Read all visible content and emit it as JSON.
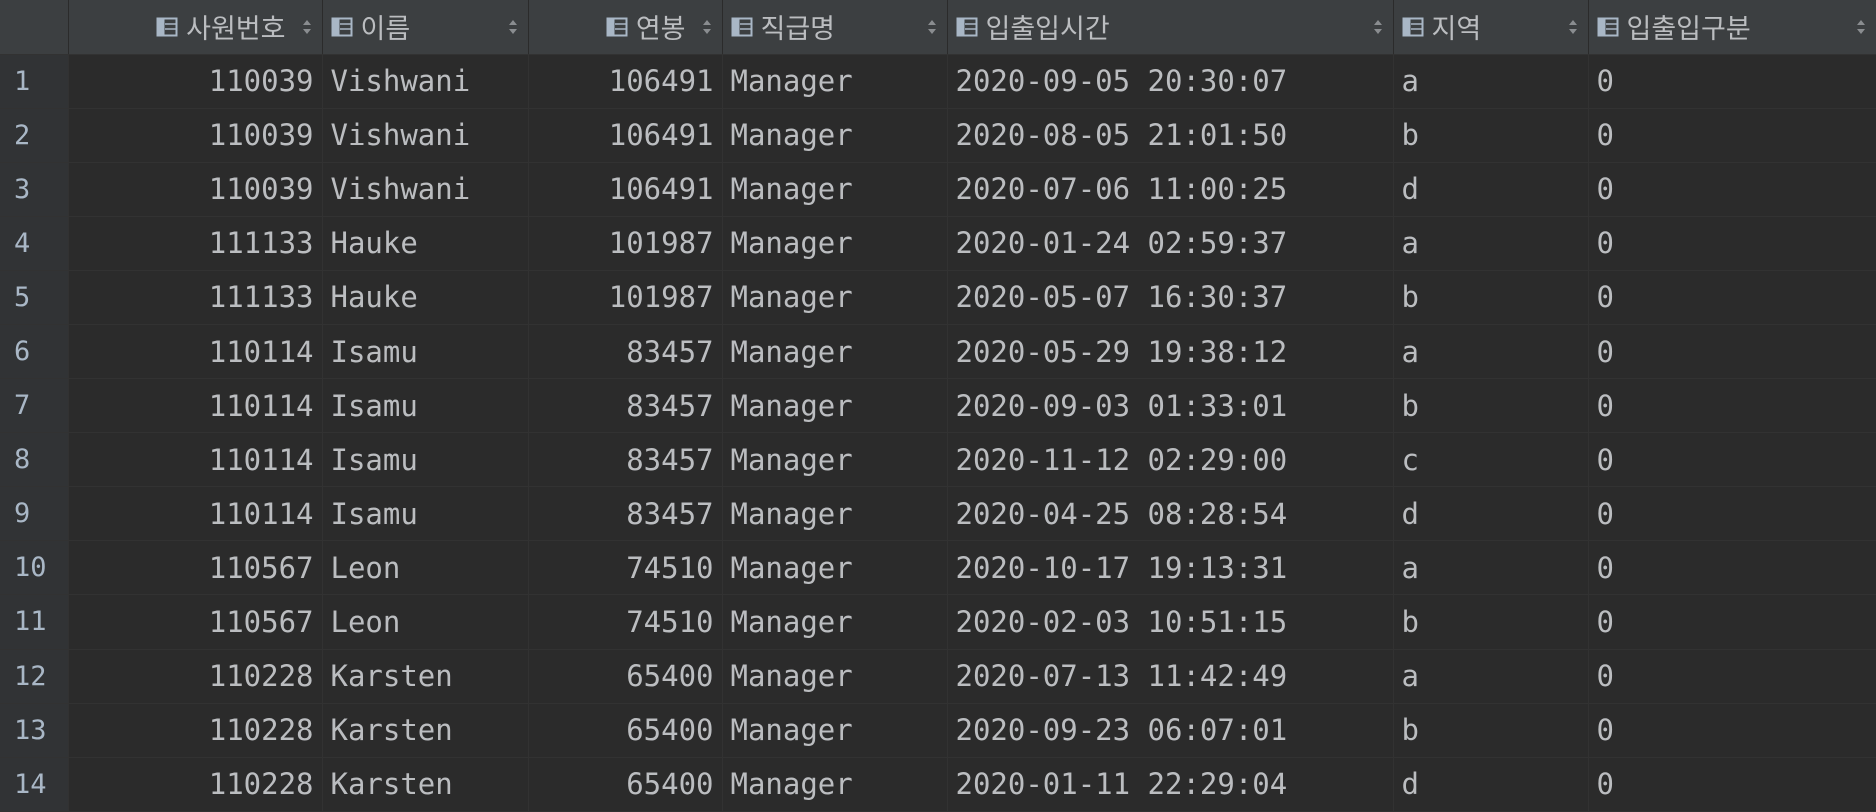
{
  "table": {
    "columns": [
      {
        "label": "사원번호",
        "align": "right"
      },
      {
        "label": "이름",
        "align": "left"
      },
      {
        "label": "연봉",
        "align": "right"
      },
      {
        "label": "직급명",
        "align": "left"
      },
      {
        "label": "입출입시간",
        "align": "left"
      },
      {
        "label": "지역",
        "align": "left"
      },
      {
        "label": "입출입구분",
        "align": "left"
      }
    ],
    "rows": [
      {
        "num": "1",
        "cells": [
          "110039",
          "Vishwani",
          "106491",
          "Manager",
          "2020-09-05 20:30:07",
          "a",
          "0"
        ]
      },
      {
        "num": "2",
        "cells": [
          "110039",
          "Vishwani",
          "106491",
          "Manager",
          "2020-08-05 21:01:50",
          "b",
          "0"
        ]
      },
      {
        "num": "3",
        "cells": [
          "110039",
          "Vishwani",
          "106491",
          "Manager",
          "2020-07-06 11:00:25",
          "d",
          "0"
        ]
      },
      {
        "num": "4",
        "cells": [
          "111133",
          "Hauke",
          "101987",
          "Manager",
          "2020-01-24 02:59:37",
          "a",
          "0"
        ]
      },
      {
        "num": "5",
        "cells": [
          "111133",
          "Hauke",
          "101987",
          "Manager",
          "2020-05-07 16:30:37",
          "b",
          "0"
        ]
      },
      {
        "num": "6",
        "cells": [
          "110114",
          "Isamu",
          "83457",
          "Manager",
          "2020-05-29 19:38:12",
          "a",
          "0"
        ]
      },
      {
        "num": "7",
        "cells": [
          "110114",
          "Isamu",
          "83457",
          "Manager",
          "2020-09-03 01:33:01",
          "b",
          "0"
        ]
      },
      {
        "num": "8",
        "cells": [
          "110114",
          "Isamu",
          "83457",
          "Manager",
          "2020-11-12 02:29:00",
          "c",
          "0"
        ]
      },
      {
        "num": "9",
        "cells": [
          "110114",
          "Isamu",
          "83457",
          "Manager",
          "2020-04-25 08:28:54",
          "d",
          "0"
        ]
      },
      {
        "num": "10",
        "cells": [
          "110567",
          "Leon",
          "74510",
          "Manager",
          "2020-10-17 19:13:31",
          "a",
          "0"
        ]
      },
      {
        "num": "11",
        "cells": [
          "110567",
          "Leon",
          "74510",
          "Manager",
          "2020-02-03 10:51:15",
          "b",
          "0"
        ]
      },
      {
        "num": "12",
        "cells": [
          "110228",
          "Karsten",
          "65400",
          "Manager",
          "2020-07-13 11:42:49",
          "a",
          "0"
        ]
      },
      {
        "num": "13",
        "cells": [
          "110228",
          "Karsten",
          "65400",
          "Manager",
          "2020-09-23 06:07:01",
          "b",
          "0"
        ]
      },
      {
        "num": "14",
        "cells": [
          "110228",
          "Karsten",
          "65400",
          "Manager",
          "2020-01-11 22:29:04",
          "d",
          "0"
        ]
      }
    ]
  },
  "icons": {
    "column": "column-icon",
    "sort": "sort-icon"
  },
  "colors": {
    "background": "#2b2b2b",
    "header": "#3c3f41",
    "gutter": "#313335",
    "text": "#bbbdc0",
    "grid": "#323232"
  }
}
